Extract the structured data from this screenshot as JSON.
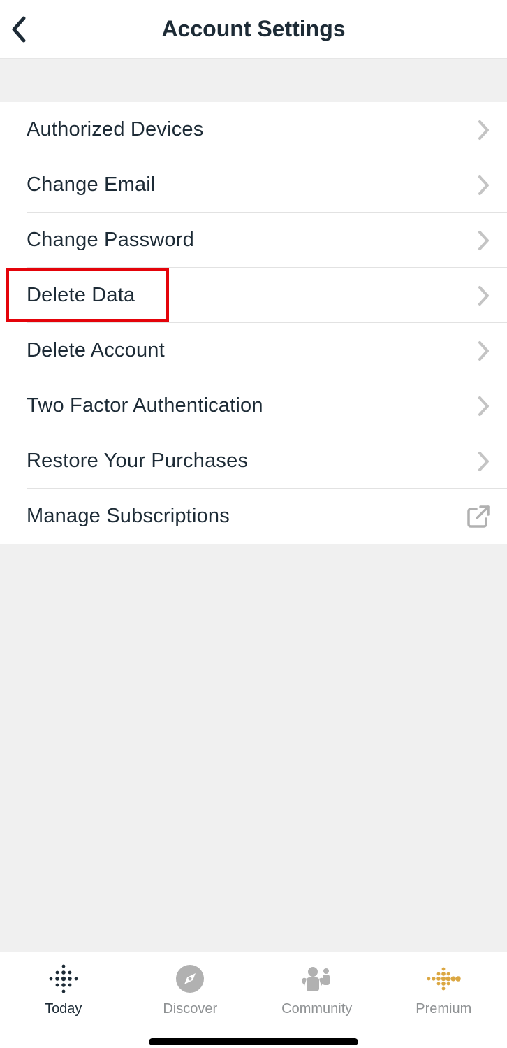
{
  "header": {
    "title": "Account Settings"
  },
  "settings": [
    {
      "label": "Authorized Devices",
      "icon": "chevron"
    },
    {
      "label": "Change Email",
      "icon": "chevron"
    },
    {
      "label": "Change Password",
      "icon": "chevron"
    },
    {
      "label": "Delete Data",
      "icon": "chevron"
    },
    {
      "label": "Delete Account",
      "icon": "chevron"
    },
    {
      "label": "Two Factor Authentication",
      "icon": "chevron"
    },
    {
      "label": "Restore Your Purchases",
      "icon": "chevron"
    },
    {
      "label": "Manage Subscriptions",
      "icon": "external"
    }
  ],
  "highlighted_index": 3,
  "tabs": [
    {
      "label": "Today",
      "active": true,
      "icon": "fitbit"
    },
    {
      "label": "Discover",
      "active": false,
      "icon": "compass"
    },
    {
      "label": "Community",
      "active": false,
      "icon": "people"
    },
    {
      "label": "Premium",
      "active": false,
      "icon": "premium"
    }
  ]
}
